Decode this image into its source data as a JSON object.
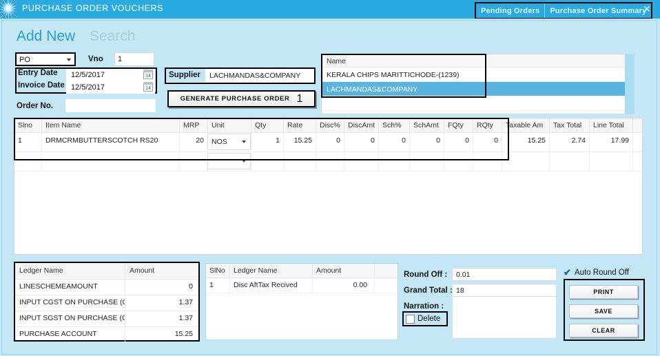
{
  "window": {
    "title": "PURCHASE ORDER VOUCHERS",
    "logo_icon": "sunburst-logo-icon",
    "close_icon": "✕",
    "tabs": [
      {
        "label": "Pending Orders"
      },
      {
        "label": "Purchase Order Summary"
      }
    ],
    "accent": "#29abe2",
    "body_bg": "#c3e7f4"
  },
  "header": {
    "add_new": "Add New",
    "search": "Search"
  },
  "form": {
    "voucher_type": {
      "value": "PO",
      "caret_icon": "chevron-down-icon"
    },
    "vno_label": "Vno",
    "vno_value": "1",
    "entry_date_label": "Entry Date",
    "entry_date_value": "12/5/2017",
    "invoice_date_label": "Invoice Date",
    "invoice_date_value": "12/5/2017",
    "calendar_icon_day": "14",
    "order_no_label": "Order No.",
    "order_no_value": "",
    "supplier_label": "Supplier",
    "supplier_value": "LACHMANDAS&COMPANY",
    "generate_button": "GENERATE PURCHASE ORDER",
    "generate_step_number": "1"
  },
  "name_panel": {
    "header": "Name",
    "rows": [
      {
        "label": "KERALA CHIPS MARITTICHODE-(1239)",
        "selected": false
      },
      {
        "label": "LACHMANDAS&COMPANY",
        "selected": true
      },
      {
        "label": "",
        "selected": false
      }
    ],
    "selected_bg": "#5ab4e0"
  },
  "item_grid": {
    "columns": [
      "Slno",
      "Item Name",
      "MRP",
      "Unit",
      "Qty",
      "Rate",
      "Disc%",
      "DiscAmt",
      "Sch%",
      "SchAmt",
      "FQty",
      "RQty",
      "Taxable Am",
      "Tax Total",
      "Line Total",
      ""
    ],
    "row": {
      "slno": "1",
      "item_name": "DRMCRMBUTTERSCOTCH RS20",
      "mrp": "20",
      "unit": "NOS",
      "qty": "1",
      "rate": "15.25",
      "disc_pct": "0",
      "disc_amt": "0",
      "sch_pct": "0",
      "sch_amt": "0",
      "fqty": "0",
      "rqty": "0",
      "taxable_amt": "15.25",
      "tax_total": "2.74",
      "line_total": "17.99"
    },
    "unit_caret_icon": "chevron-down-icon"
  },
  "ledger_table": {
    "columns": [
      "Ledger Name",
      "Amount"
    ],
    "rows": [
      {
        "name": "LINESCHEMEAMOUNT",
        "amount": "0"
      },
      {
        "name": "INPUT CGST ON PURCHASE (GST",
        "amount": "1.37"
      },
      {
        "name": "INPUT SGST ON PURCHASE (GST",
        "amount": "1.37"
      },
      {
        "name": "PURCHASE ACCOUNT",
        "amount": "15.25"
      }
    ]
  },
  "ledger_table2": {
    "columns": [
      "SlNo",
      "Ledger Name",
      "Amount"
    ],
    "rows": [
      {
        "slno": "1",
        "name": "Disc AftTax Recived",
        "amount": "0.00"
      }
    ]
  },
  "totals": {
    "round_off_label": "Round Off :",
    "round_off_value": "0.01",
    "grand_total_label": "Grand Total :",
    "grand_total_value": "18",
    "narration_label": "Narration :",
    "narration_value": "",
    "delete_label": "Delete",
    "delete_checked": false,
    "auto_round_label": "Auto Round Off",
    "auto_round_checked": true,
    "check_icon": "✔"
  },
  "actions": {
    "print": "PRINT",
    "save": "SAVE",
    "clear": "CLEAR"
  }
}
